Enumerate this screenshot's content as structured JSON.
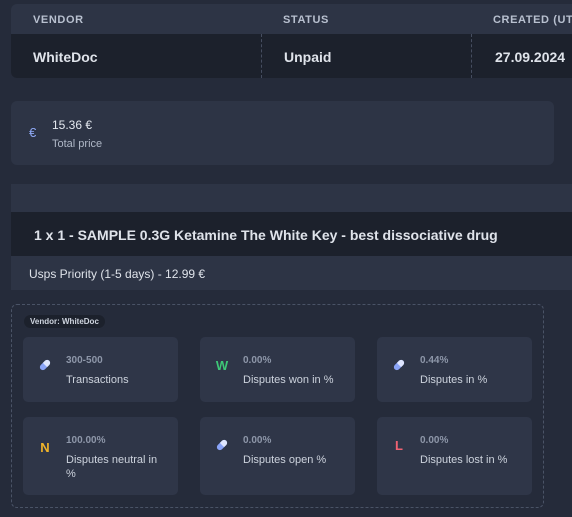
{
  "order": {
    "columns": [
      "VENDOR",
      "STATUS",
      "CREATED (UTC"
    ],
    "values": [
      "WhiteDoc",
      "Unpaid",
      "27.09.2024"
    ]
  },
  "price": {
    "icon": "euro-icon",
    "value": "15.36 €",
    "label": "Total price"
  },
  "item": {
    "title": "1 x 1 - SAMPLE 0.3G Ketamine The White Key - best dissociative drug",
    "shipping": "Usps Priority (1-5 days) - 12.99 €"
  },
  "vendor": {
    "badge": "Vendor: WhiteDoc",
    "stats": [
      {
        "icon": "pill-icon",
        "color": "#8aa4f8",
        "value": "300-500",
        "label": "Transactions"
      },
      {
        "icon": "letter-w-icon",
        "glyph": "W",
        "color": "#3ec777",
        "value": "0.00%",
        "label": "Disputes won in %"
      },
      {
        "icon": "pill-icon",
        "color": "#8aa4f8",
        "value": "0.44%",
        "label": "Disputes in %"
      },
      {
        "icon": "letter-n-icon",
        "glyph": "N",
        "color": "#f0b429",
        "value": "100.00%",
        "label": "Disputes neutral in %"
      },
      {
        "icon": "pill-icon",
        "color": "#8aa4f8",
        "value": "0.00%",
        "label": "Disputes open %"
      },
      {
        "icon": "letter-l-icon",
        "glyph": "L",
        "color": "#f06272",
        "value": "0.00%",
        "label": "Disputes lost in %"
      }
    ]
  }
}
